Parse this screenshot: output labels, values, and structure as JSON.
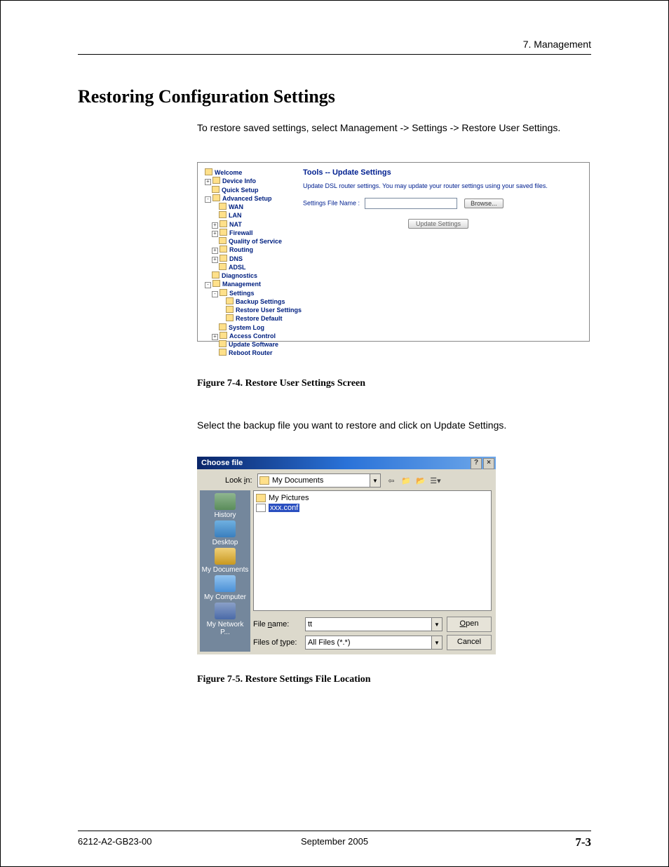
{
  "header": "7. Management",
  "h1": "Restoring Configuration Settings",
  "intro": "To restore saved settings, select Management -> Settings -> Restore User Settings.",
  "figure1": {
    "panel_title": "Tools -- Update Settings",
    "panel_desc": "Update DSL router settings. You may update your router settings using your saved files.",
    "file_label": "Settings File Name :",
    "browse": "Browse...",
    "update": "Update Settings",
    "caption": "Figure 7-4.    Restore User Settings Screen",
    "tree": {
      "welcome": "Welcome",
      "device_info": "Device Info",
      "quick_setup": "Quick Setup",
      "advanced_setup": "Advanced Setup",
      "wan": "WAN",
      "lan": "LAN",
      "nat": "NAT",
      "firewall": "Firewall",
      "qos": "Quality of Service",
      "routing": "Routing",
      "dns": "DNS",
      "adsl": "ADSL",
      "diagnostics": "Diagnostics",
      "management": "Management",
      "settings": "Settings",
      "backup": "Backup Settings",
      "restore_user": "Restore User Settings",
      "restore_default": "Restore Default",
      "system_log": "System Log",
      "access_control": "Access Control",
      "update_software": "Update Software",
      "reboot": "Reboot Router"
    }
  },
  "select_text": "Select the backup file you want to restore and click on Update Settings.",
  "figure2": {
    "title": "Choose file",
    "help_btn": "?",
    "close_btn": "×",
    "lookin_label": "Look in:",
    "lookin_value": "My Documents",
    "places": {
      "history": "History",
      "desktop": "Desktop",
      "mydocs": "My Documents",
      "mycomp": "My Computer",
      "mynet": "My Network P..."
    },
    "file_list": {
      "item1": "My Pictures",
      "item2": "xxx.conf"
    },
    "filename_label": "File name:",
    "filename_value": "tt",
    "filetype_label": "Files of type:",
    "filetype_value": "All Files (*.*)",
    "open": "Open",
    "cancel": "Cancel",
    "caption": "Figure 7-5.    Restore Settings File Location"
  },
  "footer": {
    "left": "6212-A2-GB23-00",
    "center": "September 2005",
    "right": "7-3"
  }
}
